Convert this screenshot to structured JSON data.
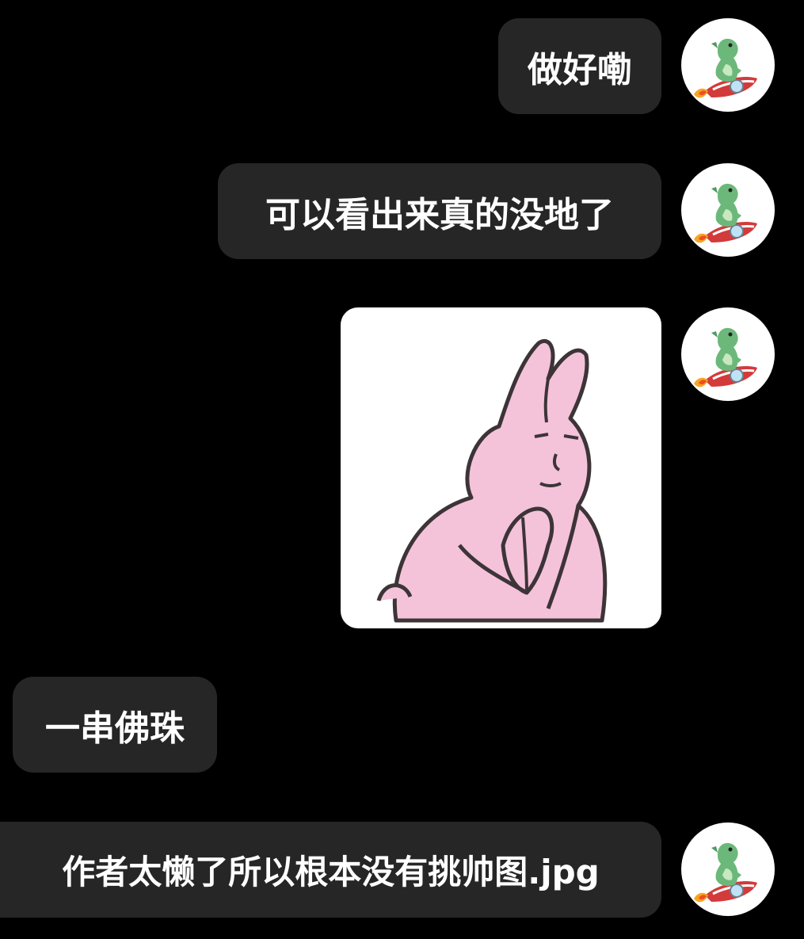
{
  "chat": {
    "messages": [
      {
        "sender": "me",
        "type": "text",
        "text": "做好嘞"
      },
      {
        "sender": "me",
        "type": "text",
        "text": "可以看出来真的没地了"
      },
      {
        "sender": "me",
        "type": "image",
        "image_icon": "praying-pink-rabbit-sticker"
      },
      {
        "sender": "other",
        "type": "text",
        "text": "一串佛珠"
      },
      {
        "sender": "me",
        "type": "text",
        "text": "作者太懒了所以根本没有挑帅图.jpg"
      }
    ]
  },
  "avatar": {
    "icon": "green-dinosaur-on-rocket-icon"
  },
  "colors": {
    "background": "#000000",
    "bubble": "#262626",
    "text": "#ffffff",
    "avatar_bg": "#ffffff",
    "rabbit": "#f4c3d9"
  }
}
